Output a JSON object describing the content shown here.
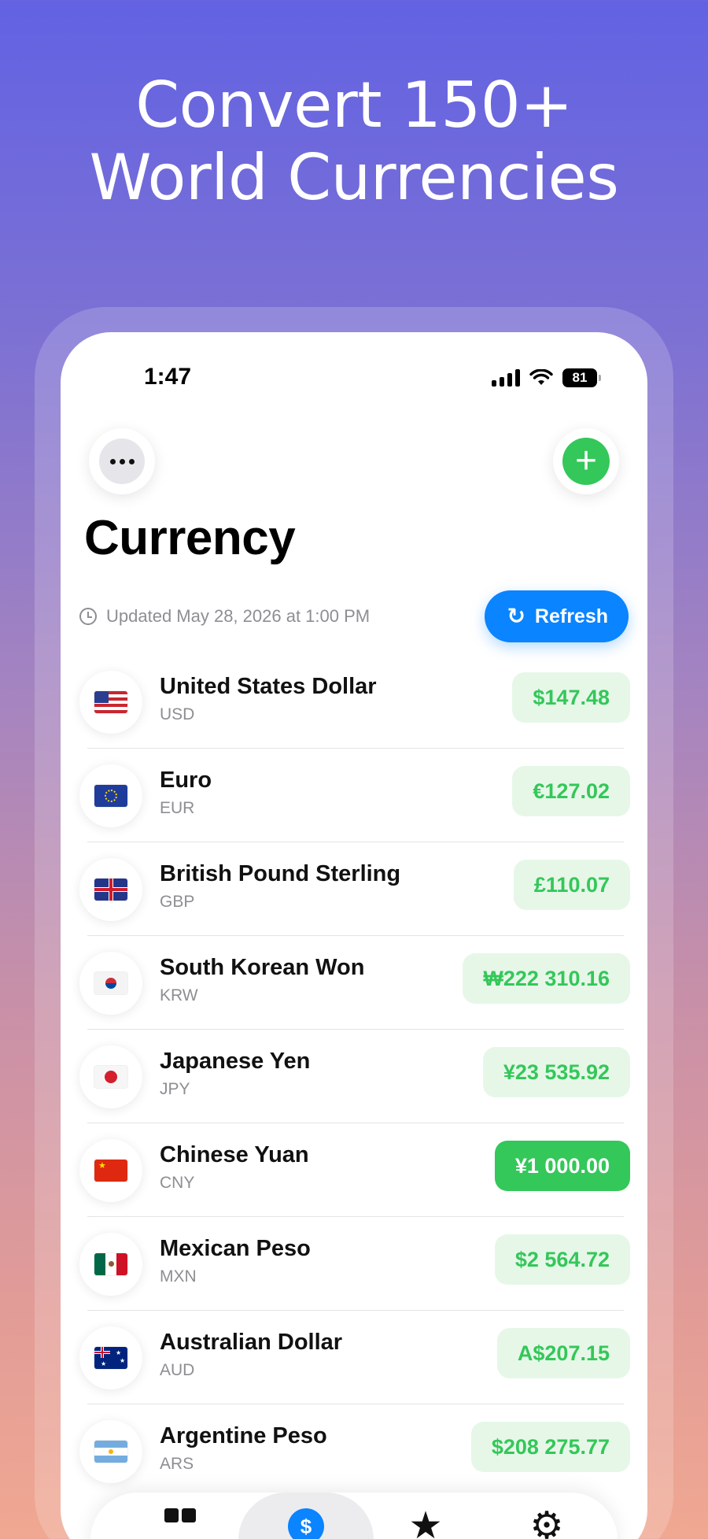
{
  "headline": {
    "line1": "Convert 150+",
    "line2": "World Currencies"
  },
  "status_bar": {
    "time": "1:47",
    "battery": "81"
  },
  "header": {
    "title": "Currency",
    "updated": "Updated May 28, 2026 at 1:00 PM",
    "refresh_label": "Refresh"
  },
  "icons": {
    "more": "more-icon",
    "add": "plus-icon",
    "clock": "clock-icon",
    "refresh": "refresh-icon"
  },
  "colors": {
    "accent_green": "#34c759",
    "accent_blue": "#0a84ff",
    "amount_bg": "#e6f7e8"
  },
  "currencies": [
    {
      "name": "United States Dollar",
      "code": "USD",
      "amount": "$147.48",
      "selected": false
    },
    {
      "name": "Euro",
      "code": "EUR",
      "amount": "€127.02",
      "selected": false
    },
    {
      "name": "British Pound Sterling",
      "code": "GBP",
      "amount": "£110.07",
      "selected": false
    },
    {
      "name": "South Korean Won",
      "code": "KRW",
      "amount": "₩222 310.16",
      "selected": false
    },
    {
      "name": "Japanese Yen",
      "code": "JPY",
      "amount": "¥23 535.92",
      "selected": false
    },
    {
      "name": "Chinese Yuan",
      "code": "CNY",
      "amount": "¥1 000.00",
      "selected": true
    },
    {
      "name": "Mexican Peso",
      "code": "MXN",
      "amount": "$2 564.72",
      "selected": false
    },
    {
      "name": "Australian Dollar",
      "code": "AUD",
      "amount": "A$207.15",
      "selected": false
    },
    {
      "name": "Argentine Peso",
      "code": "ARS",
      "amount": "$208 275.77",
      "selected": false
    }
  ],
  "tabbar": {
    "tabs": [
      {
        "icon": "grid-icon",
        "active": false
      },
      {
        "icon": "dollar-icon",
        "active": true
      },
      {
        "icon": "star-icon",
        "active": false
      },
      {
        "icon": "gear-icon",
        "active": false
      }
    ]
  }
}
